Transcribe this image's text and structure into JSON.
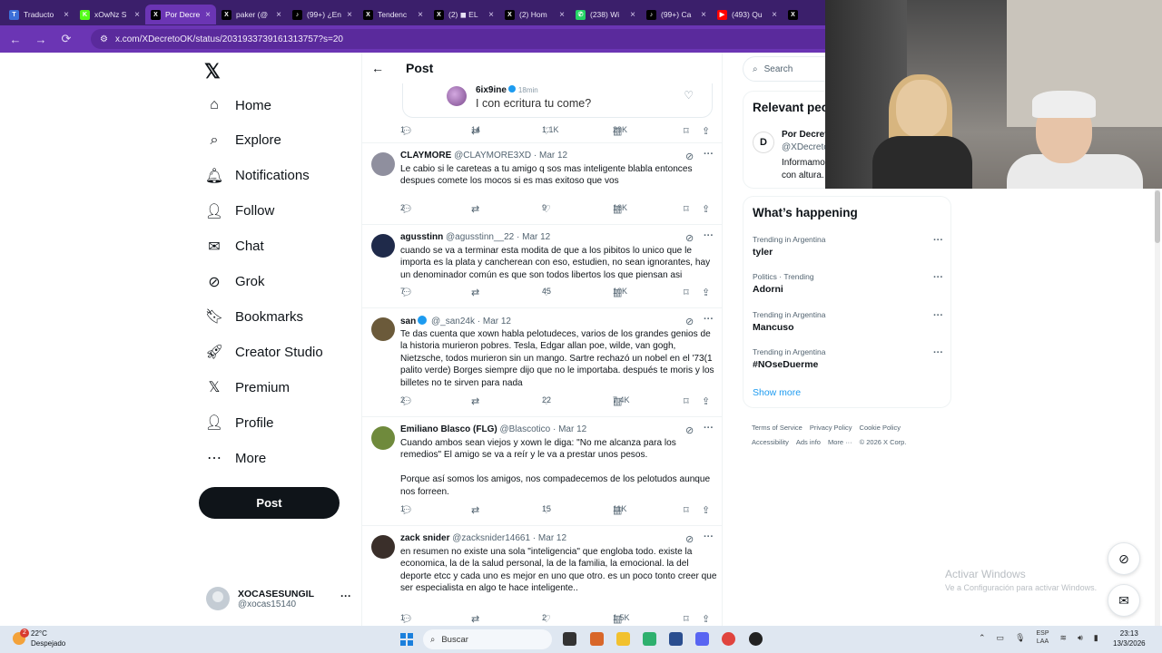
{
  "browser": {
    "tabs": [
      {
        "label": "Traducto",
        "icon": "translate-icon",
        "color": "#3b6fd8"
      },
      {
        "label": "xOwNz S",
        "icon": "kick-icon",
        "color": "#53fc18"
      },
      {
        "label": "Por Decre",
        "icon": "x-icon",
        "color": "#000000",
        "active": true
      },
      {
        "label": "paker (@",
        "icon": "x-icon",
        "color": "#000000"
      },
      {
        "label": "(99+) ¿En",
        "icon": "tiktok-icon",
        "color": "#000000"
      },
      {
        "label": "Tendenc",
        "icon": "x-icon",
        "color": "#000000"
      },
      {
        "label": "(2) ◼ EL",
        "icon": "x-icon",
        "color": "#000000"
      },
      {
        "label": "(2) Hom",
        "icon": "x-icon",
        "color": "#000000"
      },
      {
        "label": "(238) Wi",
        "icon": "whatsapp-icon",
        "color": "#25d366"
      },
      {
        "label": "(99+) Ca",
        "icon": "tiktok-icon",
        "color": "#000000"
      },
      {
        "label": "(493) Qu",
        "icon": "youtube-icon",
        "color": "#ff0000"
      },
      {
        "label": "",
        "icon": "x-icon",
        "color": "#000000"
      }
    ],
    "url": "x.com/XDecretoOK/status/2031933739161313757?s=20"
  },
  "nav": {
    "items": [
      {
        "label": "Home",
        "icon": "home-icon"
      },
      {
        "label": "Explore",
        "icon": "search-icon"
      },
      {
        "label": "Notifications",
        "icon": "bell-icon"
      },
      {
        "label": "Follow",
        "icon": "add-person-icon"
      },
      {
        "label": "Chat",
        "icon": "mail-icon"
      },
      {
        "label": "Grok",
        "icon": "grok-icon"
      },
      {
        "label": "Bookmarks",
        "icon": "bookmark-icon"
      },
      {
        "label": "Creator Studio",
        "icon": "rocket-icon"
      },
      {
        "label": "Premium",
        "icon": "x-icon"
      },
      {
        "label": "Profile",
        "icon": "person-icon"
      },
      {
        "label": "More",
        "icon": "more-circle-icon"
      }
    ],
    "post_label": "Post",
    "account": {
      "name": "XOCASESUNGIL",
      "handle": "@xocas15140"
    }
  },
  "main": {
    "title": "Post",
    "quoted": {
      "name": "6ix9ine",
      "time": "18min",
      "text": "I con ecritura tu come?"
    },
    "quoted_stats": {
      "replies": "1",
      "reposts": "14",
      "likes": "1.1K",
      "views": "29K"
    },
    "tweets": [
      {
        "name": "CLAYMORE",
        "handle": "@CLAYMORE3XD",
        "date": "Mar 12",
        "verified": false,
        "avatar": "#8f8f9e",
        "text": "Le cabio si le careteas a tu amigo q sos mas inteligente blabla entonces despues comete los mocos si es mas exitoso que vos",
        "replies": "2",
        "reposts": "",
        "likes": "9",
        "views": "16K"
      },
      {
        "name": "agusstinn",
        "handle": "@agusstinn__22",
        "date": "Mar 12",
        "verified": false,
        "avatar": "#1f2a4a",
        "text": "cuando se va a terminar esta modita de que a los pibitos lo unico que le importa es la plata y cancherean con eso, estudien, no sean ignorantes, hay un denominador común es que son todos libertos los que piensan asi",
        "replies": "7",
        "reposts": "",
        "likes": "45",
        "views": "10K"
      },
      {
        "name": "san",
        "handle": "@_san24k",
        "date": "Mar 12",
        "verified": true,
        "avatar": "#6b5a3a",
        "text": "Te das cuenta que xown habla pelotudeces, varios de los grandes genios de la historia murieron pobres. Tesla, Edgar allan poe, wilde, van gogh, Nietzsche, todos murieron sin un mango. Sartre rechazó un nobel en el '73(1 palito verde) Borges siempre dijo que no le importaba. después te moris y los billetes no te sirven para nada",
        "replies": "2",
        "reposts": "",
        "likes": "22",
        "views": "7.4K"
      },
      {
        "name": "Emiliano Blasco (FLG)",
        "handle": "@Blascotico",
        "date": "Mar 12",
        "verified": false,
        "avatar": "#6f8a3c",
        "text": "Cuando ambos sean viejos y xown le diga: \"No me alcanza para los remedios\" El amigo se va a reír y le va a prestar unos pesos.\n\nPorque así somos los amigos, nos compadecemos de los pelotudos aunque nos forreen.",
        "replies": "1",
        "reposts": "",
        "likes": "15",
        "views": "11K"
      },
      {
        "name": "zack snider",
        "handle": "@zacksnider14661",
        "date": "Mar 12",
        "verified": false,
        "avatar": "#3a2f2a",
        "text": "en resumen no existe una sola \"inteligencia\" que engloba todo. existe la economica, la de la salud personal,  la de la familia, la emocional. la del deporte  etcc y cada uno es mejor en uno que otro. es un poco tonto creer que ser especialista en algo te hace inteligente..",
        "replies": "1",
        "reposts": "",
        "likes": "2",
        "views": "1.5K"
      }
    ]
  },
  "sidebar": {
    "search_placeholder": "Search",
    "relevant_title": "Relevant people",
    "relevant": {
      "name": "Por Decreto",
      "handle": "@XDecreto",
      "bio": "Informamos con altura."
    },
    "happening_title": "What’s happening",
    "trends": [
      {
        "meta": "Trending in Argentina",
        "name": "tyler"
      },
      {
        "meta": "Politics · Trending",
        "name": "Adorni"
      },
      {
        "meta": "Trending in Argentina",
        "name": "Mancuso"
      },
      {
        "meta": "Trending in Argentina",
        "name": "#NOseDuerme"
      }
    ],
    "show_more": "Show more",
    "footer": [
      "Terms of Service",
      "Privacy Policy",
      "Cookie Policy",
      "Accessibility",
      "Ads info",
      "More ···",
      "© 2026 X Corp."
    ]
  },
  "watermark": {
    "title": "Activar Windows",
    "subtitle": "Ve a Configuración para activar Windows."
  },
  "taskbar": {
    "weather_temp": "22°C",
    "weather_desc": "Despejado",
    "weather_badge": "2",
    "search_placeholder": "Buscar",
    "lang_top": "ESP",
    "lang_bottom": "LAA",
    "time": "23:13",
    "date": "13/3/2026"
  }
}
